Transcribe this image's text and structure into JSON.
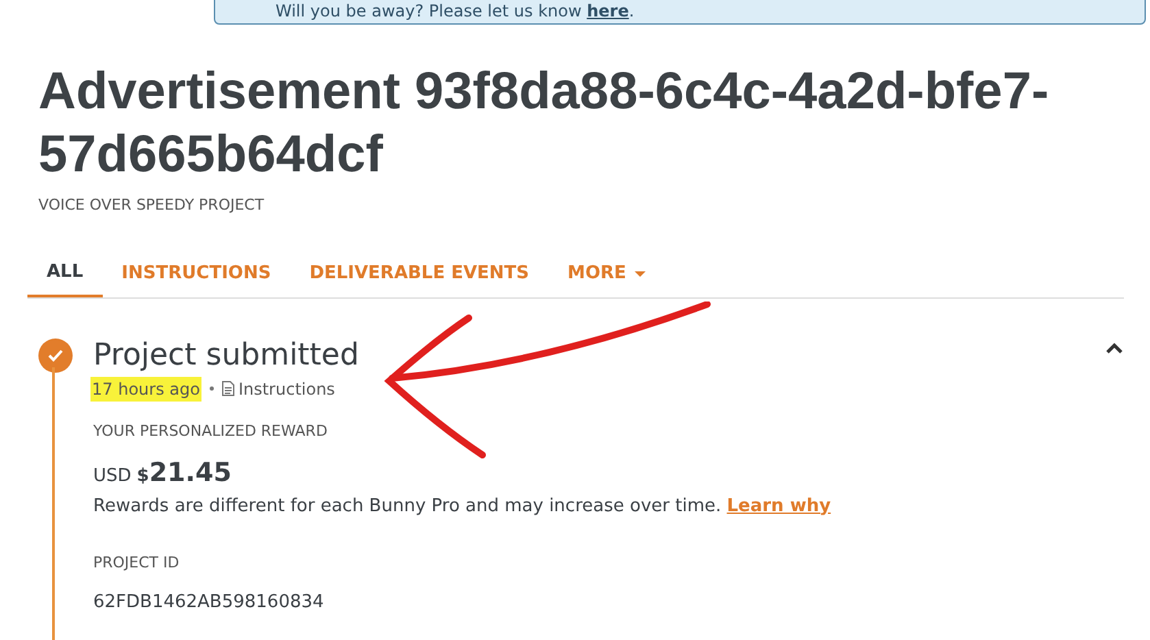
{
  "banner": {
    "text": "Will you be away? Please let us know ",
    "link": "here",
    "end": "."
  },
  "title": "Advertisement 93f8da88-6c4c-4a2d-bfe7-57d665b64dcf",
  "subtitle": "VOICE OVER SPEEDY PROJECT",
  "tabs": [
    {
      "label": "ALL",
      "selected": true,
      "has_menu": false
    },
    {
      "label": "INSTRUCTIONS",
      "selected": false,
      "has_menu": false
    },
    {
      "label": "DELIVERABLE EVENTS",
      "selected": false,
      "has_menu": false
    },
    {
      "label": "MORE",
      "selected": false,
      "has_menu": true
    }
  ],
  "event": {
    "title": "Project submitted",
    "done": true,
    "expanded": true,
    "time": "17 hours ago",
    "time_highlighted": true,
    "link": "Instructions",
    "reward": {
      "label": "YOUR PERSONALIZED REWARD",
      "currency": "USD",
      "symbol": "$",
      "amount": "21.45",
      "note": "Rewards are different for each Bunny Pro and may increase over time.",
      "note_link": "Learn why"
    },
    "project_id": {
      "label": "PROJECT ID",
      "value": "62FDB1462AB598160834"
    }
  }
}
